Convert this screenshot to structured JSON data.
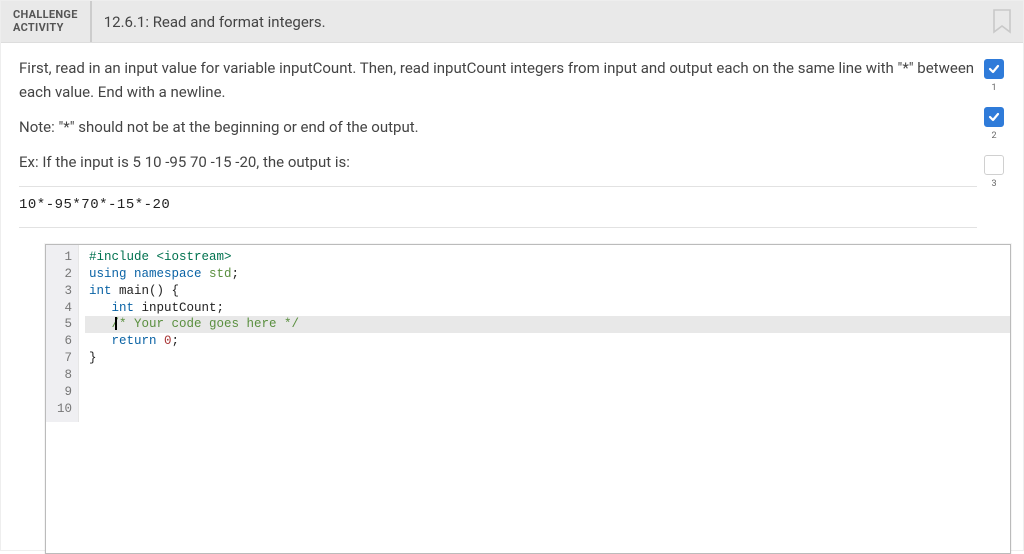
{
  "header": {
    "label_line1": "CHALLENGE",
    "label_line2": "ACTIVITY",
    "title": "12.6.1: Read and format integers."
  },
  "instructions": {
    "p1": "First, read in an input value for variable inputCount. Then, read inputCount integers from input and output each on the same line with \"*\" between each value. End with a newline.",
    "note": "Note: \"*\" should not be at the beginning or end of the output.",
    "example_label": "Ex: If the input is 5 10 -95 70 -15 -20, the output is:",
    "example_output": "10*-95*70*-15*-20"
  },
  "progress": {
    "steps": [
      {
        "n": "1",
        "done": true
      },
      {
        "n": "2",
        "done": true
      },
      {
        "n": "3",
        "done": false
      }
    ]
  },
  "code": {
    "lines": [
      {
        "n": "1",
        "tokens": [
          [
            "tok-pre",
            "#include "
          ],
          [
            "tok-pre",
            "<iostream>"
          ]
        ]
      },
      {
        "n": "2",
        "tokens": [
          [
            "tok-kw",
            "using "
          ],
          [
            "tok-kw",
            "namespace "
          ],
          [
            "tok-id",
            "std"
          ],
          [
            "tok-def",
            ";"
          ]
        ]
      },
      {
        "n": "3",
        "tokens": [
          [
            "tok-def",
            ""
          ]
        ]
      },
      {
        "n": "4",
        "tokens": [
          [
            "tok-type",
            "int "
          ],
          [
            "tok-def",
            "main() {"
          ]
        ]
      },
      {
        "n": "5",
        "tokens": [
          [
            "tok-def",
            "   "
          ],
          [
            "tok-type",
            "int "
          ],
          [
            "tok-def",
            "inputCount;"
          ]
        ]
      },
      {
        "n": "6",
        "tokens": [
          [
            "tok-def",
            ""
          ]
        ]
      },
      {
        "n": "7",
        "hl": true,
        "cursor": true,
        "tokens": [
          [
            "tok-def",
            "   "
          ],
          [
            "tok-com",
            "/* Your code goes here */"
          ]
        ]
      },
      {
        "n": "8",
        "tokens": [
          [
            "tok-def",
            ""
          ]
        ]
      },
      {
        "n": "9",
        "tokens": [
          [
            "tok-def",
            "   "
          ],
          [
            "tok-kw",
            "return "
          ],
          [
            "tok-num",
            "0"
          ],
          [
            "tok-def",
            ";"
          ]
        ]
      },
      {
        "n": "10",
        "tokens": [
          [
            "tok-def",
            "}"
          ]
        ]
      }
    ]
  }
}
